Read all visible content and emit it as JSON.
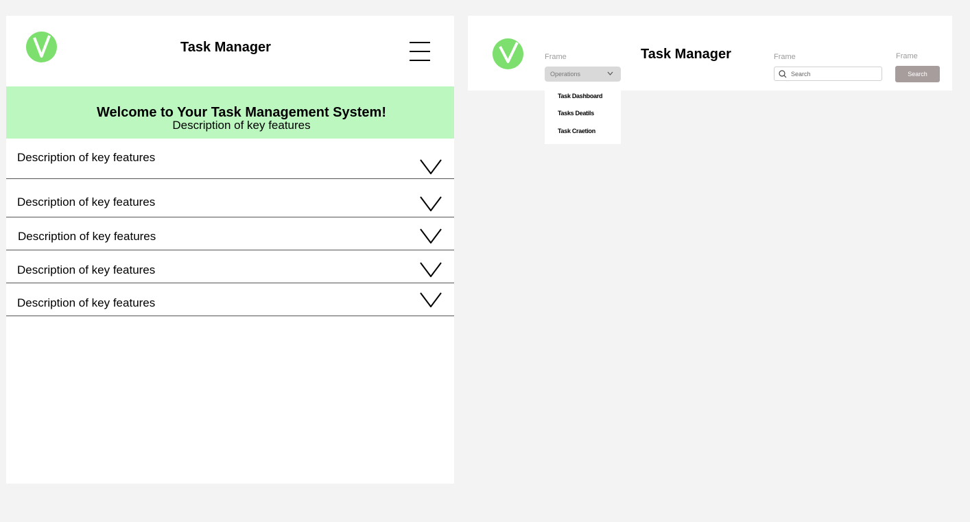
{
  "mobile": {
    "title": "Task Manager",
    "banner": {
      "title": "Welcome to Your Task Management System!",
      "subtitle": "Description of key features"
    },
    "features": [
      {
        "label": "Description of key features"
      },
      {
        "label": "Description of key features"
      },
      {
        "label": "Description of key features"
      },
      {
        "label": "Description of key features"
      },
      {
        "label": "Description of key features"
      }
    ]
  },
  "desktop": {
    "title": "Task Manager",
    "frame_labels": [
      "Frame",
      "Frame",
      "Frame"
    ],
    "dropdown": {
      "value": "Operations",
      "options": [
        "Task Dashboard",
        "Tasks Deatils",
        "Task Craetion"
      ]
    },
    "search": {
      "placeholder": "Search",
      "button_label": "Search"
    }
  },
  "colors": {
    "page_background": "#f3f3f3",
    "frame_background": "#ffffff",
    "logo_green": "#7ddf6d",
    "banner_green": "#bdf7c0",
    "search_button": "#a89d9d",
    "dropdown_background": "#d9d9d9"
  },
  "icons": [
    "logo-check-icon",
    "hamburger-menu-icon",
    "chevron-down-icon",
    "search-icon"
  ]
}
